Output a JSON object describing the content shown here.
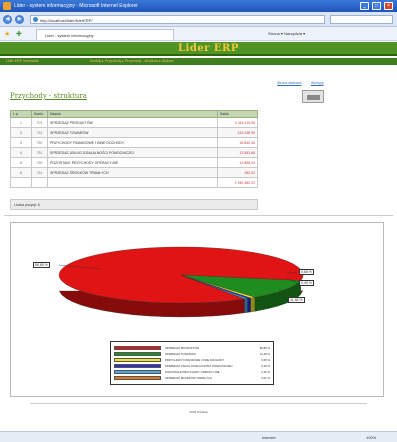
{
  "window": {
    "title": "Lider - system informacyjny - Microsoft Internet Explorer"
  },
  "address": {
    "url": "http://localhost/lider/liderERP/"
  },
  "favorites": {
    "tab_label": "Lider - system informacyjny",
    "tools_text": "Strona ▾ Narzędzia ▾"
  },
  "banner": {
    "brand": "Lider ERP"
  },
  "menu": {
    "left": "Lider ERP Informator",
    "center": "Moduły ▸ Przychody ▸ Przychody - struktura ▸ Wykres"
  },
  "top_links": {
    "link1": "Strona startowa",
    "link2": "Wyloguj"
  },
  "page": {
    "title": "Przychody - struktura"
  },
  "table": {
    "headers": {
      "lp": "L.p.",
      "kod": "Konto",
      "nazwa": "Nazwa",
      "saldo": "Saldo"
    },
    "rows": [
      {
        "lp": "1",
        "kod": "701",
        "nazwa": "SPRZEDAŻ PRODUKTÓW",
        "saldo": "2 416 119,06"
      },
      {
        "lp": "2",
        "kod": "731",
        "nazwa": "SPRZEDAŻ TOWARÓW",
        "saldo": "319 248,99"
      },
      {
        "lp": "3",
        "kod": "750",
        "nazwa": "PRZYCHODY FINANSOWE I INNE DOCHODY",
        "saldo": "18 840,45"
      },
      {
        "lp": "4",
        "kod": "751",
        "nazwa": "SPRZEDAŻ USŁUG DZIAŁALNOŚCI POMOCNICZEJ",
        "saldo": "13 583,68"
      },
      {
        "lp": "5",
        "kod": "760",
        "nazwa": "POZOSTAŁE PRZYCHODY OPERACYJNE",
        "saldo": "12 858,24"
      },
      {
        "lp": "6",
        "kod": "761",
        "nazwa": "SPRZEDAŻ ŚRODKÓW TRWAŁYCH",
        "saldo": "150,00"
      }
    ],
    "total": "2 780 480,22",
    "count_label": "Liczba pozycji: 6"
  },
  "chart_data": {
    "type": "pie",
    "style": "3d",
    "legend_position": "bottom-center",
    "categories": [
      "SPRZEDAŻ PRODUKTÓW",
      "SPRZEDAŻ TOWARÓW",
      "PRZYCHODY FINANSOWE I INNE DOCHODY",
      "SPRZEDAŻ USŁUG DZIAŁALNOŚCI POMOCNICZEJ",
      "POZOSTAŁE PRZYCHODY OPERACYJNE",
      "SPRZEDAŻ ŚRODKÓW TRWAŁYCH"
    ],
    "values": [
      86.89,
      11.48,
      0.68,
      0.49,
      0.46,
      0.01
    ],
    "value_labels": [
      "86,89 %",
      "11,48 %",
      "0,68 %",
      "0,49 %",
      "0,46 %",
      "0,01 %"
    ],
    "colors": [
      "#e01414",
      "#1e8c1e",
      "#f2e41c",
      "#2c2cd0",
      "#4aa8e8",
      "#e07820"
    ]
  },
  "callouts": {
    "big": "86,89 %",
    "r1": "0,68 %",
    "r2": "0,49 %",
    "r3": "11,48 %"
  },
  "footer": {
    "text": "2009 Tobdata"
  },
  "status": {
    "zone": "Internet",
    "zoom": "100%"
  }
}
